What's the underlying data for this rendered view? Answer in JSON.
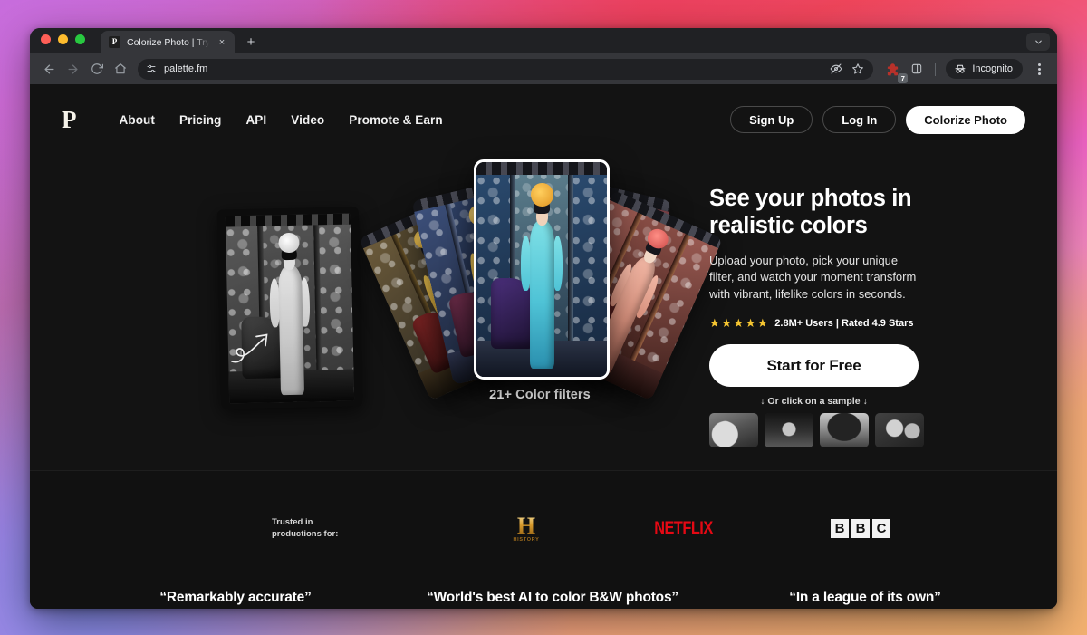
{
  "browser": {
    "tab": {
      "favicon_letter": "P",
      "title": "Colorize Photo | Try Free | Re",
      "close_icon": "×"
    },
    "new_tab_icon": "+",
    "tab_search_icon": "chevron-down-icon",
    "toolbar": {
      "back_icon": "←",
      "forward_icon": "→",
      "reload_icon": "⟳",
      "home_icon": "⌂",
      "url": "palette.fm",
      "site_settings_icon": "tune-icon",
      "hide_icon": "eye-off-icon",
      "bookmark_icon": "star-icon",
      "extensions_icon": "extension-icon",
      "extensions_badge": "7",
      "split_icon": "split-view-icon",
      "incognito_label": "Incognito",
      "menu_icon": "kebab-menu-icon"
    }
  },
  "site": {
    "brand": "P",
    "nav": [
      {
        "label": "About"
      },
      {
        "label": "Pricing"
      },
      {
        "label": "API"
      },
      {
        "label": "Video"
      },
      {
        "label": "Promote & Earn"
      }
    ],
    "actions": {
      "sign_up": "Sign Up",
      "log_in": "Log In",
      "colorize": "Colorize Photo"
    }
  },
  "hero": {
    "heading": "See your photos in\nrealistic colors",
    "subheading": "Upload your photo, pick your unique\nfilter, and watch your moment transform\nwith vibrant, lifelike colors in seconds.",
    "stars": "★★★★★",
    "rating_text": "2.8M+ Users | Rated 4.9 Stars",
    "cta": "Start for Free",
    "cta_hint": "↓ Or click on a sample ↓",
    "fan_caption": "21+ Color filters",
    "samples": [
      {
        "name": "sample-1"
      },
      {
        "name": "sample-2"
      },
      {
        "name": "sample-3"
      },
      {
        "name": "sample-4"
      }
    ]
  },
  "logos": {
    "trusted_label": "Trusted in\nproductions for:",
    "history": {
      "mark": "H",
      "word": "HISTORY"
    },
    "netflix": "NETFLIX",
    "bbc": [
      "B",
      "B",
      "C"
    ]
  },
  "quotes": [
    {
      "text": "“Remarkably accurate”"
    },
    {
      "text": "“World's best AI to color B&W photos”"
    },
    {
      "text": "“In a league of its own”"
    }
  ],
  "colors": {
    "page_bg": "#131313",
    "accent_white": "#ffffff",
    "star_gold": "#f5c531",
    "netflix_red": "#e50914"
  }
}
